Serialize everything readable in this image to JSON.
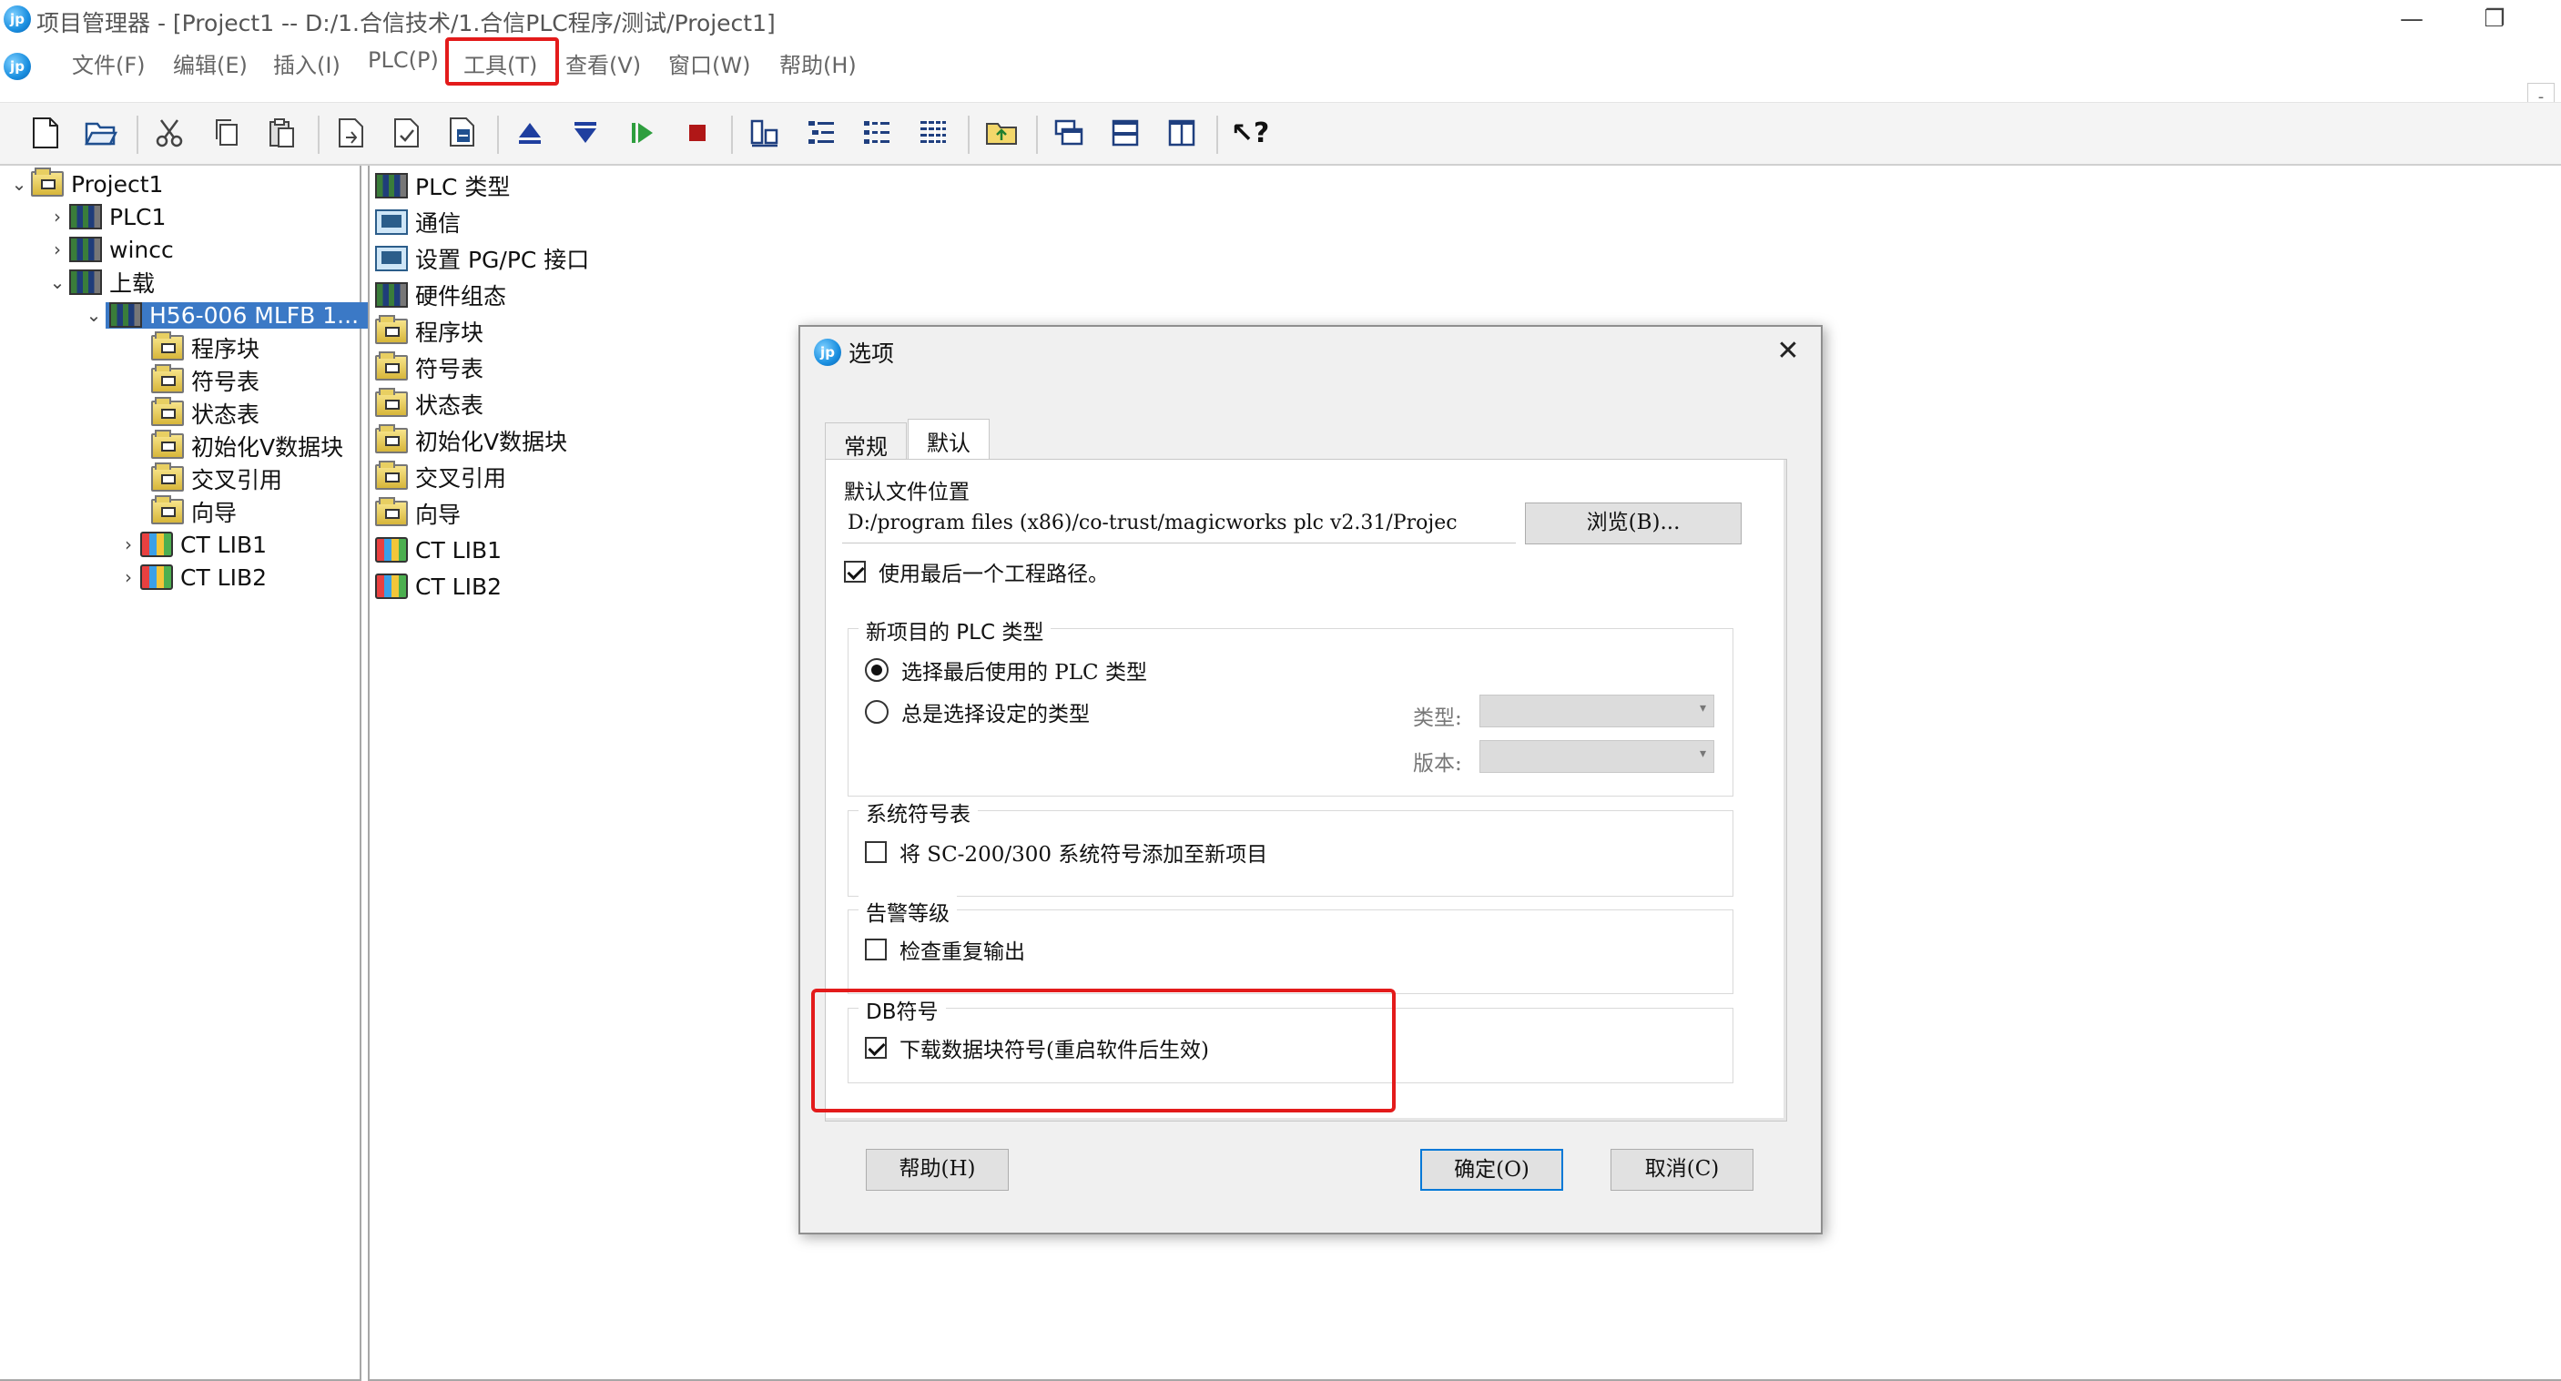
{
  "window": {
    "title": "项目管理器 - [Project1 -- D:/1.合信技术/1.合信PLC程序/测试/Project1]",
    "logo_text": "jp",
    "minimize_glyph": "—",
    "restore_glyph": "❐",
    "menu_min_glyph": "-"
  },
  "menu": {
    "items": [
      {
        "label": "文件(F)"
      },
      {
        "label": "编辑(E)"
      },
      {
        "label": "插入(I)"
      },
      {
        "label": "PLC(P)"
      },
      {
        "label": "工具(T)"
      },
      {
        "label": "查看(V)"
      },
      {
        "label": "窗口(W)"
      },
      {
        "label": "帮助(H)"
      }
    ]
  },
  "toolbar": {
    "icons": [
      "new-file-icon",
      "open-folder-icon",
      "cut-icon",
      "copy-icon",
      "paste-icon",
      "export-icon",
      "check-icon",
      "compile-icon",
      "upload-icon",
      "download-icon",
      "run-icon",
      "stop-icon",
      "module-icon",
      "list-icon",
      "detail-icon",
      "grid-icon",
      "folder-up-icon",
      "window-cascade-icon",
      "window-horizontal-icon",
      "window-vertical-icon",
      "context-help-icon"
    ],
    "help_glyph": "?"
  },
  "tree": {
    "root": "Project1",
    "items": [
      {
        "label": "PLC1",
        "chev": "›"
      },
      {
        "label": "wincc",
        "chev": "›"
      },
      {
        "label": "上载",
        "chev": "⌄"
      },
      {
        "label": "H56-006 MLFB 1...",
        "chev": "⌄"
      },
      {
        "label": "程序块"
      },
      {
        "label": "符号表"
      },
      {
        "label": "状态表"
      },
      {
        "label": "初始化V数据块"
      },
      {
        "label": "交叉引用"
      },
      {
        "label": "向导"
      },
      {
        "label": "CT LIB1",
        "chev": "›"
      },
      {
        "label": "CT LIB2",
        "chev": "›"
      }
    ],
    "root_chev": "⌄"
  },
  "list": {
    "items": [
      {
        "label": "PLC 类型"
      },
      {
        "label": "通信"
      },
      {
        "label": "设置 PG/PC 接口"
      },
      {
        "label": "硬件组态"
      },
      {
        "label": "程序块"
      },
      {
        "label": "符号表"
      },
      {
        "label": "状态表"
      },
      {
        "label": "初始化V数据块"
      },
      {
        "label": "交叉引用"
      },
      {
        "label": "向导"
      },
      {
        "label": "CT LIB1"
      },
      {
        "label": "CT LIB2"
      }
    ]
  },
  "dialog": {
    "title": "选项",
    "close_glyph": "✕",
    "tabs": [
      {
        "label": "常规"
      },
      {
        "label": "默认"
      }
    ],
    "default_path_label": "默认文件位置",
    "default_path_value": "D:/program files (x86)/co-trust/magicworks plc v2.31/Projec",
    "browse_label": "浏览(B)...",
    "use_last_path_label": "使用最后一个工程路径。",
    "use_last_path_checked": true,
    "plc_group": {
      "title": "新项目的 PLC 类型",
      "option_last": "选择最后使用的 PLC 类型",
      "option_set": "总是选择设定的类型",
      "selected": "option_last",
      "type_label": "类型:",
      "version_label": "版本:"
    },
    "symbol_group": {
      "title": "系统符号表",
      "add_label": "将 SC-200/300 系统符号添加至新项目",
      "checked": false
    },
    "warning_group": {
      "title": "告警等级",
      "check_label": "检查重复输出",
      "checked": false
    },
    "db_group": {
      "title": "DB符号",
      "download_label": "下载数据块符号(重启软件后生效)",
      "checked": true
    },
    "buttons": {
      "help": "帮助(H)",
      "ok": "确定(O)",
      "cancel": "取消(C)"
    }
  },
  "colors": {
    "highlight": "#e31b1b",
    "selection": "#3b79c6",
    "default_button_border": "#0078d7"
  }
}
